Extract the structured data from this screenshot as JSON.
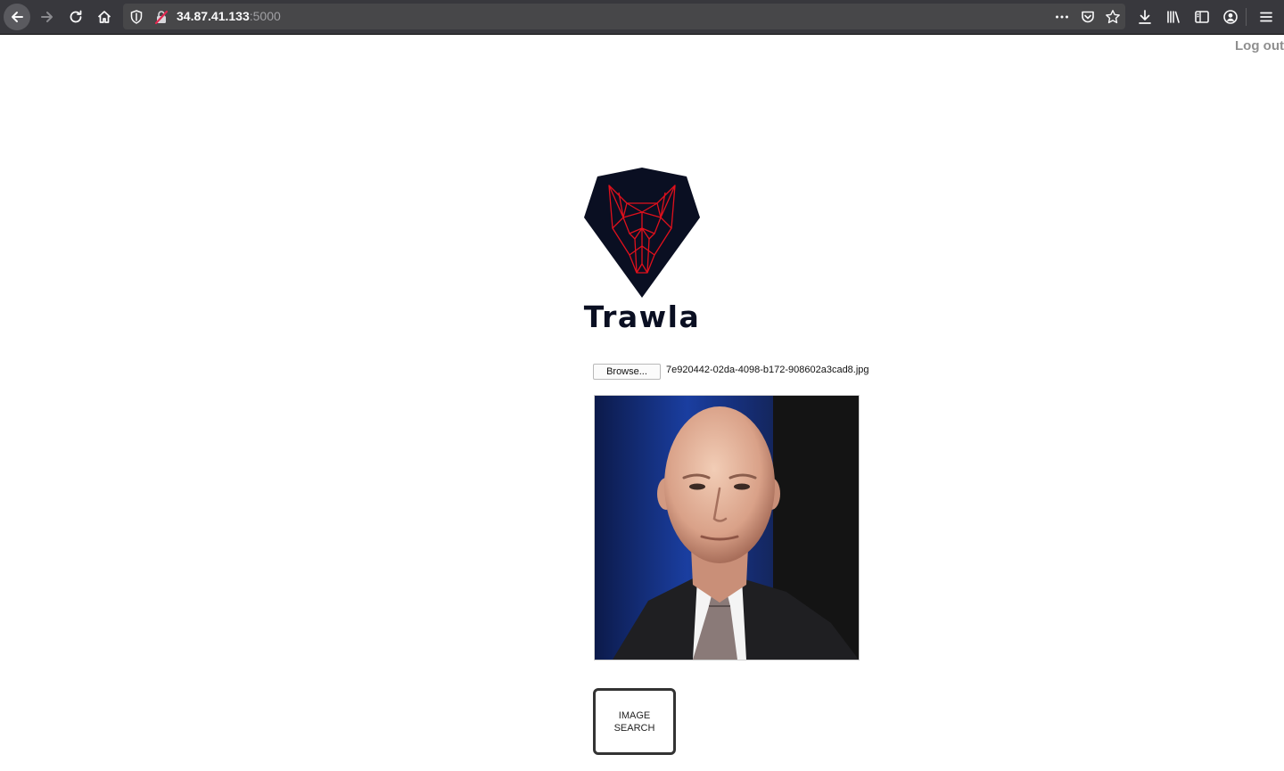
{
  "browser": {
    "url_host": "34.87.41.133",
    "url_port": ":5000",
    "icons": [
      "back-arrow-icon",
      "forward-arrow-icon",
      "reload-icon",
      "home-icon",
      "tracking-shield-icon",
      "insecure-lock-icon",
      "more-actions-icon",
      "pocket-icon",
      "bookmark-star-icon",
      "download-icon",
      "library-icon",
      "sidebar-icon",
      "account-icon",
      "menu-icon"
    ]
  },
  "header": {
    "logout_label": "Log out"
  },
  "brand": {
    "name": "Trawla",
    "logo_colors": {
      "shield": "#0a0f22",
      "lines": "#e0101c"
    }
  },
  "upload": {
    "browse_label": "Browse...",
    "filename": "7e920442-02da-4098-b172-908602a3cad8.jpg"
  },
  "actions": {
    "search_label": "IMAGE SEARCH"
  }
}
